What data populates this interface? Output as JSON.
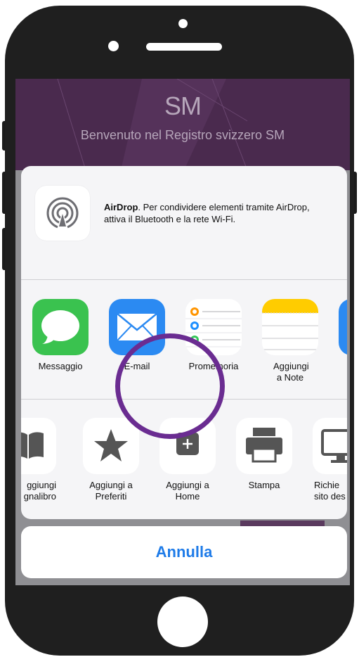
{
  "app_background": {
    "logo": "SM",
    "subtitle": "Benvenuto nel Registro svizzero SM"
  },
  "share_sheet": {
    "airdrop": {
      "icon": "airdrop-icon",
      "title": "AirDrop",
      "text": ". Per condividere elementi tramite AirDrop, attiva il Bluetooth e la rete Wi-Fi."
    },
    "apps": [
      {
        "label": "Messaggio",
        "icon": "messages-icon"
      },
      {
        "label": "E-mail",
        "icon": "mail-icon"
      },
      {
        "label": "Promemoria",
        "icon": "reminders-icon"
      },
      {
        "label": "Aggiungi a Note",
        "icon": "notes-icon"
      }
    ],
    "actions": [
      {
        "label": "Aggiungi segnalibro",
        "label_visible": "ggiungi\ngnalibro",
        "icon": "bookmark-icon"
      },
      {
        "label": "Aggiungi a Preferiti",
        "icon": "star-icon"
      },
      {
        "label": "Aggiungi a Home",
        "icon": "add-square-icon"
      },
      {
        "label": "Stampa",
        "icon": "printer-icon"
      },
      {
        "label": "Richiedi sito desktop",
        "label_visible": "Richie\nsito des",
        "icon": "desktop-icon"
      }
    ],
    "cancel_label": "Annulla"
  },
  "colors": {
    "highlight_ring": "#6a2c91",
    "cancel_text": "#1e7be8",
    "header_bg": "#4a2a4e"
  }
}
